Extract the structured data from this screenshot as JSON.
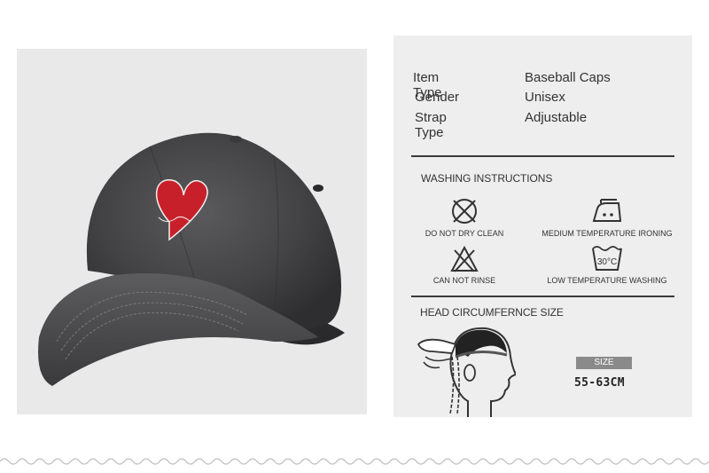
{
  "product_photo": {
    "alt_subject": "washed black baseball cap with red heart embroidery"
  },
  "specs": [
    {
      "label": "Item Type",
      "value": "Baseball Caps"
    },
    {
      "label": "Gender",
      "value": "Unisex"
    },
    {
      "label": "Strap Type",
      "value": "Adjustable"
    }
  ],
  "washing": {
    "title": "WASHING INSTRUCTIONS",
    "items": [
      {
        "label": "DO NOT DRY CLEAN",
        "icon": "no-dry-clean-icon"
      },
      {
        "label": "MEDIUM TEMPERATURE IRONING",
        "icon": "iron-medium-icon"
      },
      {
        "label": "CAN NOT RINSE",
        "icon": "no-bleach-icon"
      },
      {
        "label": "LOW TEMPERATURE WASHING",
        "icon": "wash-30c-icon",
        "temp_text": "30°C"
      }
    ]
  },
  "size": {
    "title": "HEAD CIRCUMFERNCE SIZE",
    "badge": "SIZE",
    "value": "55-63CM"
  },
  "colors": {
    "panel_bg": "#eeeeee",
    "photo_bg": "#e9e9e9",
    "cap": "#3f3f41",
    "heart": "#c8202a",
    "badge": "#8a8a8a"
  }
}
